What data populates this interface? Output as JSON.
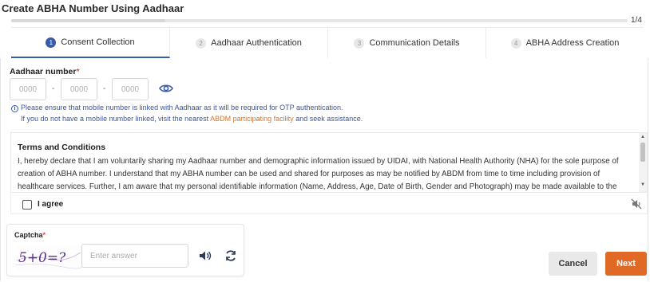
{
  "page": {
    "title": "Create ABHA Number Using Aadhaar"
  },
  "progress": {
    "label": "1/4",
    "fraction": 0.25
  },
  "steps": [
    {
      "num": "1",
      "label": "Consent Collection",
      "active": true
    },
    {
      "num": "2",
      "label": "Aadhaar Authentication",
      "active": false
    },
    {
      "num": "3",
      "label": "Communication Details",
      "active": false
    },
    {
      "num": "4",
      "label": "ABHA Address Creation",
      "active": false
    }
  ],
  "aadhaar": {
    "label": "Aadhaar number",
    "required_mark": "*",
    "placeholders": [
      "0000",
      "0000",
      "0000"
    ],
    "separator": "-",
    "toggle_icon": "eye-icon"
  },
  "info": {
    "icon": "info-icon",
    "line1": "Please ensure that mobile number is linked with Aadhaar as it will be required for OTP authentication.",
    "line2_prefix": "If you do not have a mobile number linked, visit the nearest ",
    "line2_link": "ABDM participating facility",
    "line2_suffix": " and seek assistance."
  },
  "terms": {
    "title": "Terms and Conditions",
    "body": "I, hereby declare that I am voluntarily sharing my Aadhaar number and demographic information issued by UIDAI, with National Health Authority (NHA) for the sole purpose of creation of ABHA number. I understand that my ABHA number can be used and shared for purposes as may be notified by ABDM from time to time including provision of healthcare services. Further, I am aware that my personal identifiable information (Name, Address, Age, Date of Birth, Gender and Photograph) may be made available to the"
  },
  "agree": {
    "label": "I agree",
    "checked": false,
    "audio_icon": "mute-icon"
  },
  "captcha": {
    "label": "Captcha",
    "required_mark": "*",
    "challenge": "5+0=?",
    "placeholder": "Enter answer",
    "audio_icon": "speaker-icon",
    "refresh_icon": "refresh-icon"
  },
  "buttons": {
    "cancel": "Cancel",
    "next": "Next"
  },
  "colors": {
    "accent": "#3a5ba9",
    "next": "#e06a25",
    "link": "#d9722f",
    "info": "#3b56a5"
  }
}
